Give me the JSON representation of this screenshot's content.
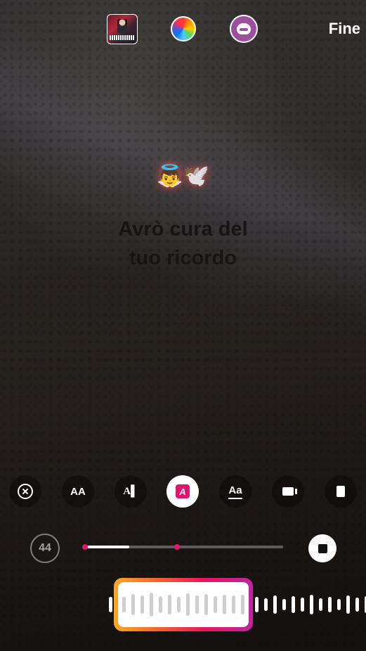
{
  "top_bar": {
    "done_label": "Fine",
    "icons": [
      "music-sticker-thumbnail",
      "color-wheel-icon",
      "face-effect-icon"
    ]
  },
  "caption": {
    "emoji": "👼🕊️",
    "line1": "Avrò cura del",
    "line2": "tuo ricordo"
  },
  "tools": [
    {
      "name": "close-icon"
    },
    {
      "name": "text-size-icon",
      "glyph": "AA"
    },
    {
      "name": "text-align-icon",
      "glyph": "A▌"
    },
    {
      "name": "text-color-icon",
      "glyph": "A",
      "active": true
    },
    {
      "name": "text-style-icon",
      "glyph": "Aa"
    },
    {
      "name": "camera-icon"
    },
    {
      "name": "page-icon"
    }
  ],
  "playback": {
    "duration": "44",
    "progress": 0.23,
    "marker": 0.47
  },
  "colors": {
    "accent": "#e0156e",
    "gradient_start": "#f9a825",
    "gradient_end": "#c123a3"
  }
}
